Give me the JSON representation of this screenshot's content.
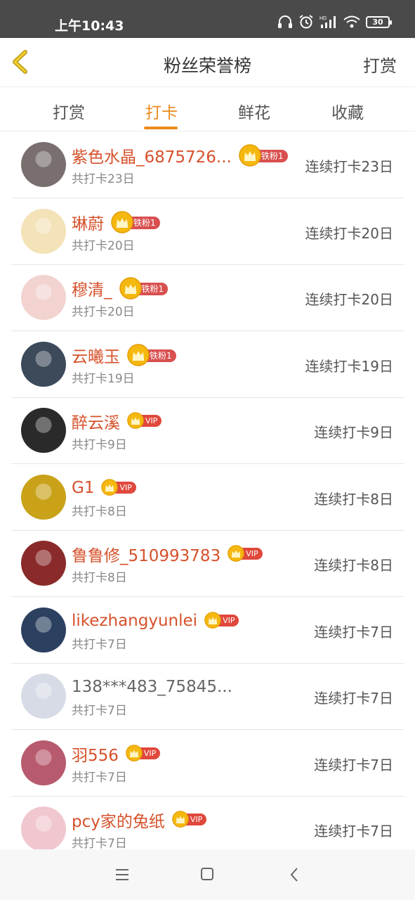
{
  "status": {
    "time": "上午10:43",
    "battery": "30"
  },
  "header": {
    "title": "粉丝荣誉榜",
    "action": "打赏"
  },
  "tabs": [
    {
      "label": "打赏",
      "active": false
    },
    {
      "label": "打卡",
      "active": true
    },
    {
      "label": "鲜花",
      "active": false
    },
    {
      "label": "收藏",
      "active": false
    }
  ],
  "rows": [
    {
      "name": "紫色水晶_6875726...",
      "badge": "铁粉1",
      "badge_type": "tiefen",
      "total": "共打卡23日",
      "streak": "连续打卡23日",
      "avatar_color": "#7a6f6f"
    },
    {
      "name": "琳蔚",
      "badge": "铁粉1",
      "badge_type": "tiefen",
      "total": "共打卡20日",
      "streak": "连续打卡20日",
      "avatar_color": "#f4e2b8"
    },
    {
      "name": "穆清_",
      "badge": "铁粉1",
      "badge_type": "tiefen",
      "total": "共打卡20日",
      "streak": "连续打卡20日",
      "avatar_color": "#f2d3d0"
    },
    {
      "name": "云曦玉",
      "badge": "铁粉1",
      "badge_type": "tiefen",
      "total": "共打卡19日",
      "streak": "连续打卡19日",
      "avatar_color": "#3c4a5a"
    },
    {
      "name": "醉云溪",
      "badge": "VIP",
      "badge_type": "vip",
      "total": "共打卡9日",
      "streak": "连续打卡9日",
      "avatar_color": "#2a2a2a"
    },
    {
      "name": "G1",
      "badge": "VIP",
      "badge_type": "vip",
      "total": "共打卡8日",
      "streak": "连续打卡8日",
      "avatar_color": "#c9a21a"
    },
    {
      "name": "鲁鲁修_510993783",
      "badge": "VIP",
      "badge_type": "vip",
      "total": "共打卡8日",
      "streak": "连续打卡8日",
      "avatar_color": "#8a2a2a"
    },
    {
      "name": "likezhangyunlei",
      "badge": "VIP",
      "badge_type": "vip",
      "total": "共打卡7日",
      "streak": "连续打卡7日",
      "avatar_color": "#2c4060"
    },
    {
      "name": "138***483_75845...",
      "badge": "",
      "badge_type": "none",
      "total": "共打卡7日",
      "streak": "连续打卡7日",
      "avatar_color": "#d6dbe6"
    },
    {
      "name": "羽556",
      "badge": "VIP",
      "badge_type": "vip",
      "total": "共打卡7日",
      "streak": "连续打卡7日",
      "avatar_color": "#b85a6e"
    },
    {
      "name": "pcy家的兔纸",
      "badge": "VIP",
      "badge_type": "vip",
      "total": "共打卡7日",
      "streak": "连续打卡7日",
      "avatar_color": "#f0c7cf"
    }
  ],
  "colors": {
    "accent": "#ec8a1e",
    "name_red": "#d6512b",
    "badge_red": "#d94f4f",
    "crown_gold": "#f5b80f"
  }
}
